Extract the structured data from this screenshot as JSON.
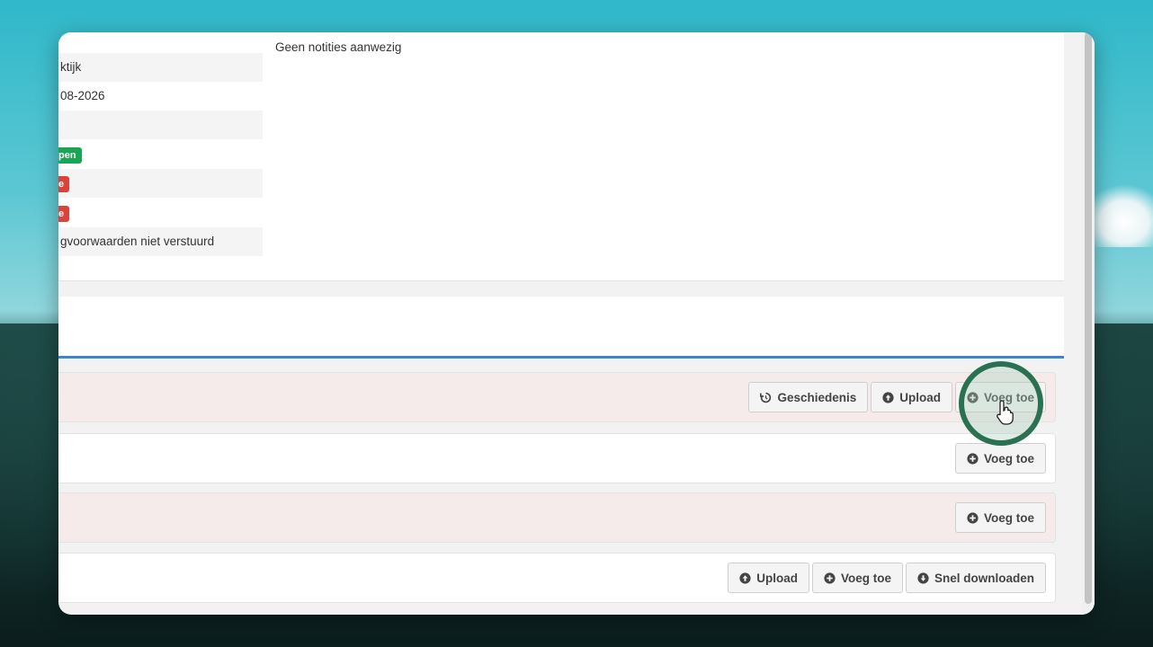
{
  "info_rows": [
    {
      "text": "ktijk"
    },
    {
      "text": "08-2026"
    },
    {
      "text": ""
    },
    {
      "text": "gvoorwaarden niet verstuurd"
    }
  ],
  "badges": [
    {
      "text": "pen",
      "color": "#1aa455"
    },
    {
      "text": "e",
      "color": "#d9433a"
    },
    {
      "text": "e",
      "color": "#d9433a"
    }
  ],
  "notes": {
    "empty_text": "Geen notities aanwezig"
  },
  "rows": [
    {
      "buttons": [
        {
          "label": "Geschiedenis",
          "icon": "history-icon"
        },
        {
          "label": "Upload",
          "icon": "upload-circle-icon"
        },
        {
          "label": "Voeg toe",
          "icon": "plus-circle-icon"
        }
      ]
    },
    {
      "buttons": [
        {
          "label": "Voeg toe",
          "icon": "plus-circle-icon"
        }
      ]
    },
    {
      "buttons": [
        {
          "label": "Voeg toe",
          "icon": "plus-circle-icon"
        }
      ]
    },
    {
      "buttons": [
        {
          "label": "Upload",
          "icon": "upload-circle-icon"
        },
        {
          "label": "Voeg toe",
          "icon": "plus-circle-icon"
        },
        {
          "label": "Snel downloaden",
          "icon": "download-circle-icon"
        }
      ]
    }
  ],
  "colors": {
    "accent_blue": "#3d85c6",
    "badge_green": "#1aa455",
    "badge_red": "#d9433a",
    "cursor_ring": "#2a7152"
  }
}
